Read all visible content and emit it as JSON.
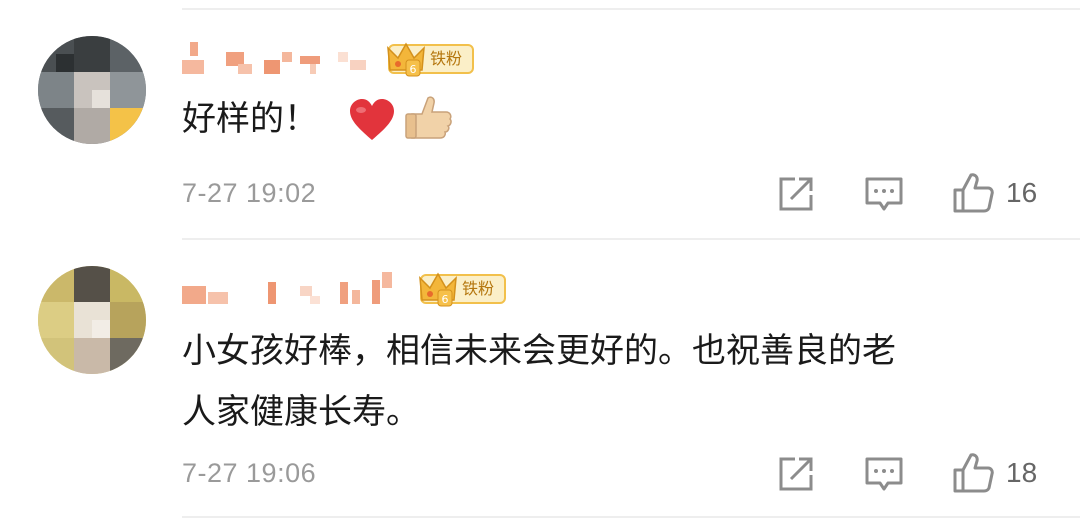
{
  "comments": [
    {
      "badge": "铁粉",
      "text": "好样的！",
      "time": "7-27 19:02",
      "likes": "16",
      "emoji": [
        "heart",
        "thumbs-up"
      ]
    },
    {
      "badge": "铁粉",
      "text_line1": "小女孩好棒，相信未来会更好的。也祝善良的老",
      "text_line2": "人家健康长寿。",
      "time": "7-27 19:06",
      "likes": "18"
    }
  ],
  "colors": {
    "badge_border": "#f2c04b",
    "badge_bg": "#fbefc8",
    "badge_text": "#b5770f",
    "icon_gray": "#8c8c8c",
    "timestamp": "#9a9a9a"
  },
  "icons": [
    "share-icon",
    "comment-icon",
    "like-icon",
    "crown-icon"
  ]
}
